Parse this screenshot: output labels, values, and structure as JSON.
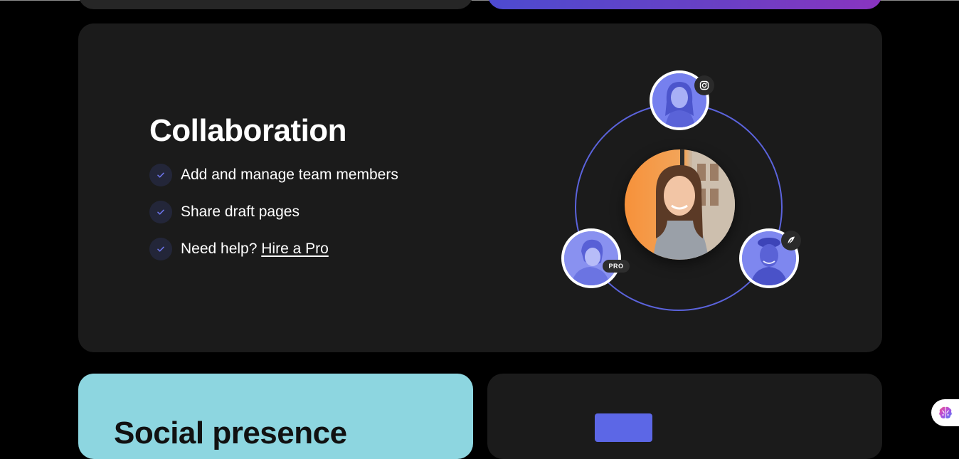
{
  "collaboration": {
    "title": "Collaboration",
    "features": [
      {
        "text": "Add and manage team members"
      },
      {
        "text": "Share draft pages"
      },
      {
        "text": "Need help?",
        "link": "Hire a Pro"
      }
    ],
    "illustration": {
      "orbit_color": "#5b63dc",
      "badges": {
        "pro": "PRO",
        "top": "instagram-icon",
        "right": "feather-icon"
      }
    }
  },
  "social": {
    "title": "Social presence"
  },
  "colors": {
    "accent": "#5b63dc",
    "social_card": "#8dd6e0",
    "card_bg": "#1b1b1b"
  }
}
